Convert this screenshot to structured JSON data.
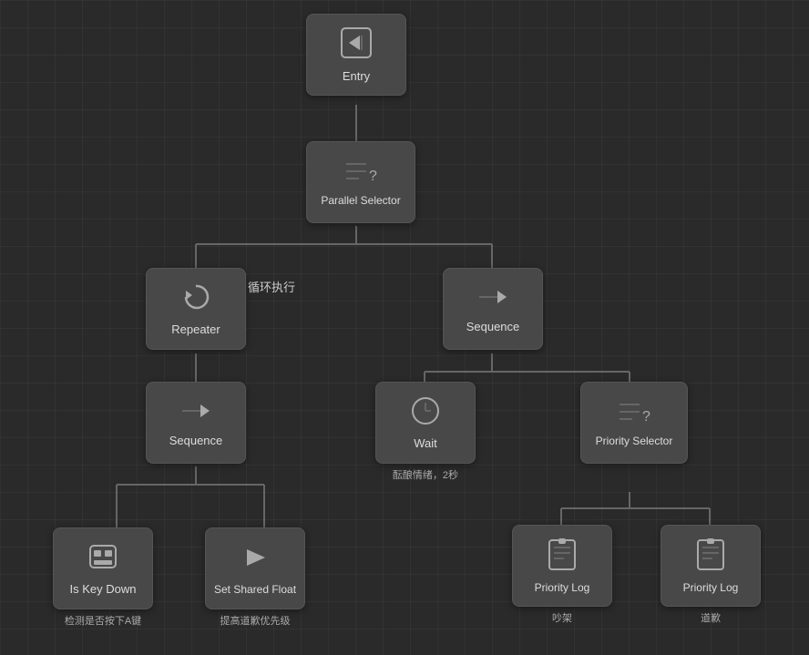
{
  "nodes": {
    "entry": {
      "label": "Entry",
      "icon": "⬛",
      "sublabel": ""
    },
    "parallel_selector": {
      "label": "Parallel Selector",
      "icon": "≡?",
      "sublabel": ""
    },
    "repeater": {
      "label": "Repeater",
      "icon": "↺",
      "sublabel": ""
    },
    "sequence1": {
      "label": "Sequence",
      "icon": "→",
      "sublabel": ""
    },
    "sequence2": {
      "label": "Sequence",
      "icon": "→",
      "sublabel": ""
    },
    "wait": {
      "label": "Wait",
      "icon": "⏱",
      "sublabel": "酝酿情绪，2秒"
    },
    "priority_selector": {
      "label": "Priority Selector",
      "icon": "≡?",
      "sublabel": ""
    },
    "is_key_down": {
      "label": "Is Key Down",
      "icon": "⊞",
      "sublabel": "检测是否按下A键"
    },
    "set_shared_float": {
      "label": "Set Shared Float",
      "icon": "▶",
      "sublabel": "提高道歉优先级"
    },
    "priority_log_1": {
      "label": "Priority Log",
      "icon": "📋",
      "sublabel": "吵架"
    },
    "priority_log_2": {
      "label": "Priority Log",
      "icon": "📋",
      "sublabel": "道歉"
    }
  },
  "annotations": {
    "loop": "循环执行"
  }
}
